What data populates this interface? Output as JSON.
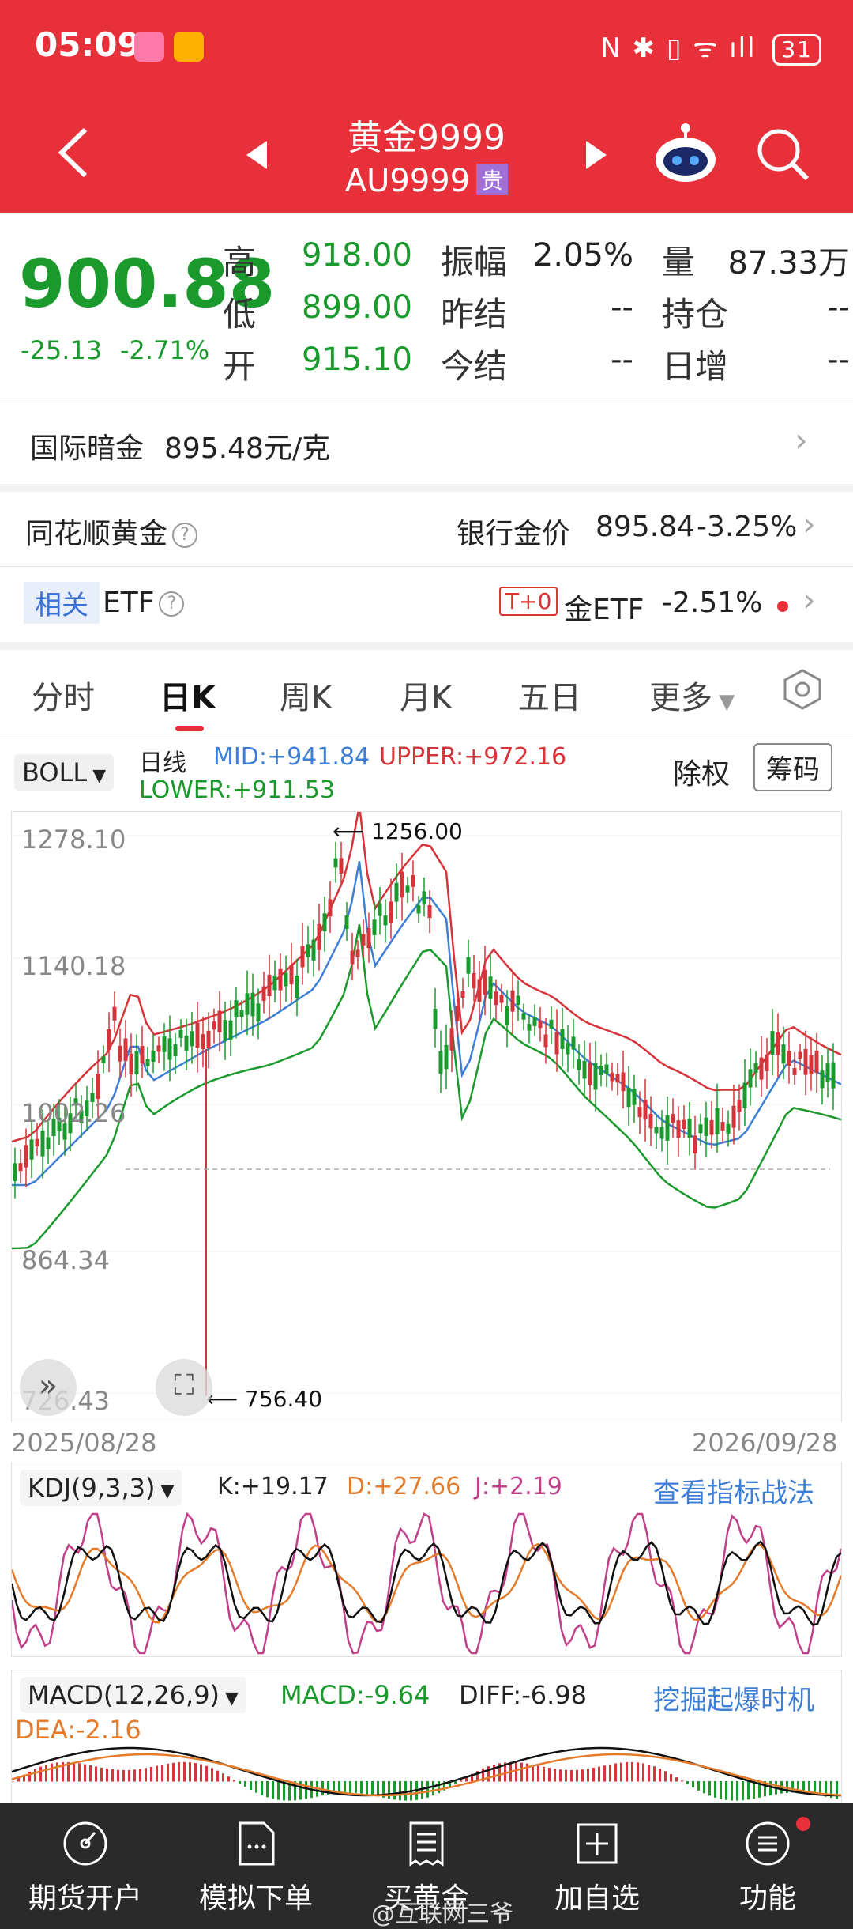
{
  "status_bar": {
    "time": "05:09",
    "icons": "N ✱ ▯ ᯤ ıll",
    "battery": "31"
  },
  "header": {
    "title": "黄金9999",
    "code": "AU9999",
    "tag": "贵"
  },
  "quote": {
    "price": "900.88",
    "change": "-25.13",
    "change_pct": "-2.71%",
    "rows": [
      {
        "l1": "高",
        "v1": "918.00",
        "l2": "振幅",
        "v2": "2.05%",
        "l3": "量",
        "v3": "87.33万"
      },
      {
        "l1": "低",
        "v1": "899.00",
        "l2": "昨结",
        "v2": "--",
        "l3": "持仓",
        "v3": "--"
      },
      {
        "l1": "开",
        "v1": "915.10",
        "l2": "今结",
        "v2": "--",
        "l3": "日增",
        "v3": "--"
      }
    ]
  },
  "intl": {
    "label": "国际暗金",
    "value": "895.48元/克"
  },
  "ths": {
    "label": "同花顺黄金",
    "bank_label": "银行金价",
    "bank_price": "895.84",
    "bank_pct": "-3.25%"
  },
  "etf": {
    "tag": "相关",
    "label": "ETF",
    "t0": "T+0",
    "name": "金ETF",
    "pct": "-2.51%"
  },
  "tabs": [
    "分时",
    "日K",
    "周K",
    "月K",
    "五日",
    "更多"
  ],
  "boll": {
    "selector": "BOLL",
    "period": "日线",
    "mid": "MID:+941.84",
    "upper": "UPPER:+972.16",
    "lower": "LOWER:+911.53",
    "adjust": "除权",
    "chips": "筹码"
  },
  "kline": {
    "y_labels": [
      "1278.10",
      "1140.18",
      "1002.26",
      "864.34",
      "726.43"
    ],
    "high_note": "1256.00",
    "low_note": "756.40",
    "start_date": "2025/08/28",
    "end_date": "2026/09/28"
  },
  "kdj": {
    "selector": "KDJ(9,3,3)",
    "k": "K:+19.17",
    "d": "D:+27.66",
    "j": "J:+2.19",
    "link": "查看指标战法"
  },
  "macd": {
    "selector": "MACD(12,26,9)",
    "macd": "MACD:-9.64",
    "diff": "DIFF:-6.98",
    "dea": "DEA:-2.16",
    "link": "挖掘起爆时机"
  },
  "bottom_nav": [
    "期货开户",
    "模拟下单",
    "买黄金",
    "加自选",
    "功能"
  ],
  "watermark": "@互联网三爷",
  "colors": {
    "header": "#e8303a",
    "down": "#1a9a2c",
    "up": "#d5343a",
    "mid": "#3d7fd6"
  }
}
